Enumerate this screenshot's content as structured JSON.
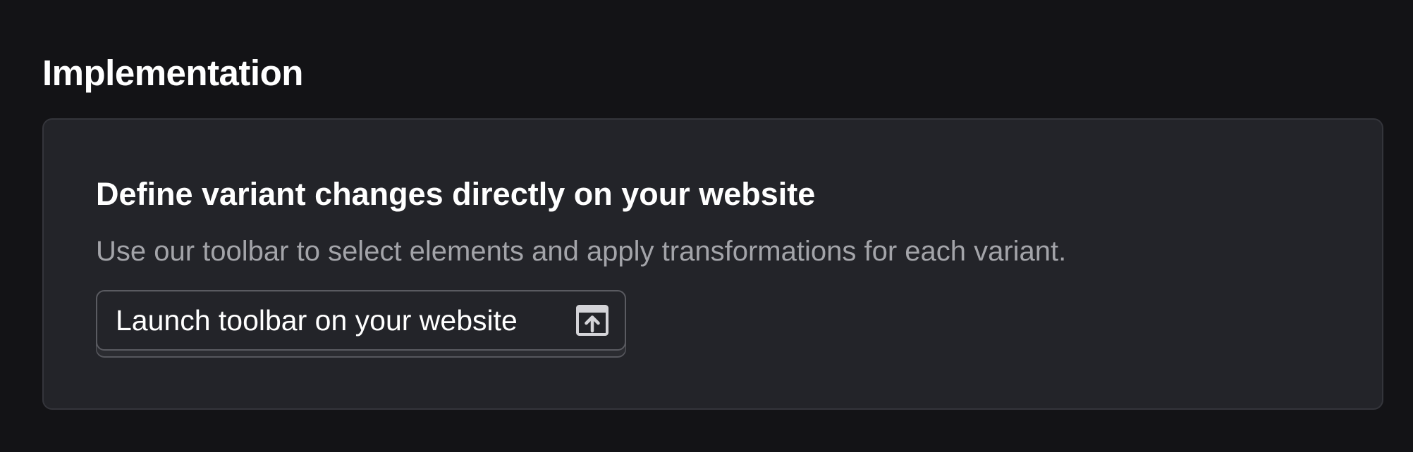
{
  "section": {
    "title": "Implementation"
  },
  "card": {
    "heading": "Define variant changes directly on your website",
    "description": "Use our toolbar to select elements and apply transformations for each variant.",
    "button_label": "Launch toolbar on your website",
    "button_icon": "open-in-new-icon"
  },
  "colors": {
    "page_background": "#131316",
    "card_background": "#232429",
    "card_border": "#34353b",
    "muted_text": "#a3a4a9",
    "button_border": "#5a5b61"
  }
}
